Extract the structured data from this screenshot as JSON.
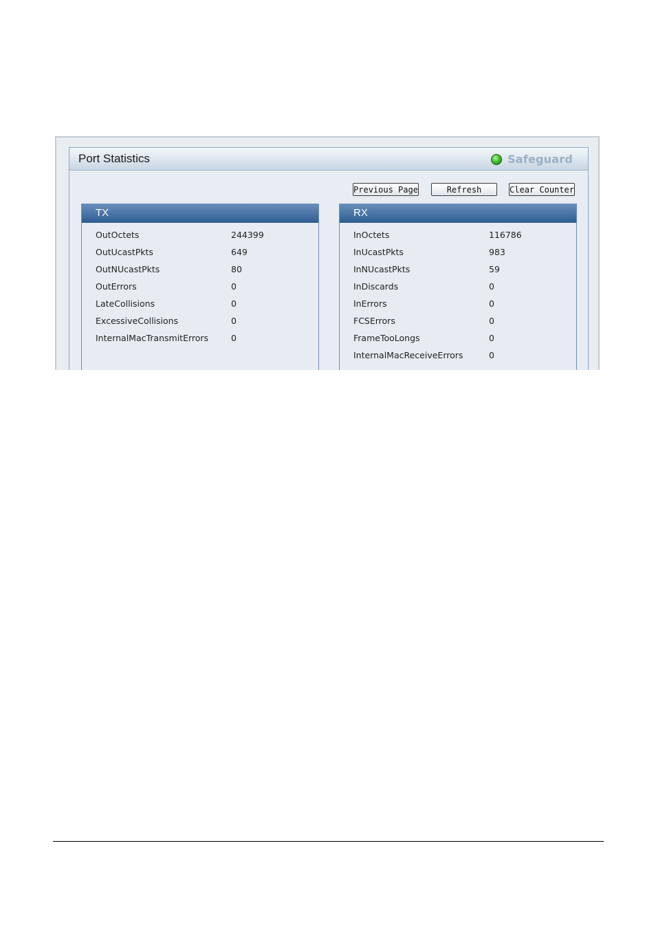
{
  "header": {
    "title": "Port Statistics",
    "brand_label": "Safeguard",
    "status_color": "#3fbf2c"
  },
  "toolbar": {
    "previous_label": "Previous Page",
    "refresh_label": "Refresh",
    "clear_label": "Clear Counter"
  },
  "tx": {
    "heading": "TX",
    "rows": [
      {
        "label": "OutOctets",
        "value": "244399"
      },
      {
        "label": "OutUcastPkts",
        "value": "649"
      },
      {
        "label": "OutNUcastPkts",
        "value": "80"
      },
      {
        "label": "OutErrors",
        "value": "0"
      },
      {
        "label": "LateCollisions",
        "value": "0"
      },
      {
        "label": "ExcessiveCollisions",
        "value": "0"
      },
      {
        "label": "InternalMacTransmitErrors",
        "value": "0"
      }
    ]
  },
  "rx": {
    "heading": "RX",
    "rows": [
      {
        "label": "InOctets",
        "value": "116786"
      },
      {
        "label": "InUcastPkts",
        "value": "983"
      },
      {
        "label": "InNUcastPkts",
        "value": "59"
      },
      {
        "label": "InDiscards",
        "value": "0"
      },
      {
        "label": "InErrors",
        "value": "0"
      },
      {
        "label": "FCSErrors",
        "value": "0"
      },
      {
        "label": "FrameTooLongs",
        "value": "0"
      },
      {
        "label": "InternalMacReceiveErrors",
        "value": "0"
      }
    ]
  }
}
